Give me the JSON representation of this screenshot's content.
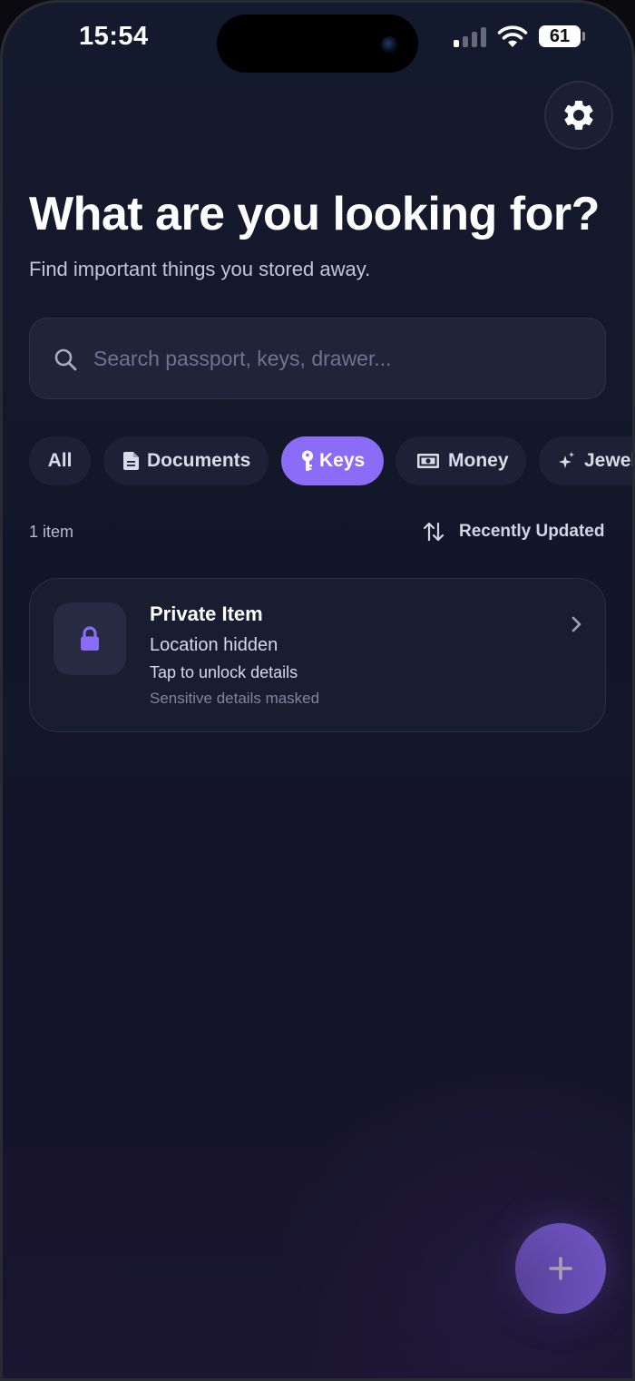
{
  "status_bar": {
    "time": "15:54",
    "battery": "61",
    "icons": [
      "cellular-signal-icon",
      "wifi-icon",
      "battery-icon"
    ]
  },
  "header": {
    "title": "What are you looking for?",
    "subtitle": "Find important things you stored away.",
    "settings_icon": "gear-icon"
  },
  "search": {
    "placeholder": "Search passport, keys, drawer...",
    "value": "",
    "icon": "search-icon"
  },
  "filters": [
    {
      "label": "All",
      "icon": "",
      "active": false
    },
    {
      "label": "Documents",
      "icon": "document-icon",
      "active": false
    },
    {
      "label": "Keys",
      "icon": "key-icon",
      "active": true
    },
    {
      "label": "Money",
      "icon": "banknote-icon",
      "active": false
    },
    {
      "label": "Jewel",
      "icon": "sparkle-icon",
      "active": false
    }
  ],
  "results": {
    "count": "1 item",
    "sort_label": "Recently Updated",
    "sort_icon": "sort-arrows-icon"
  },
  "items": [
    {
      "title": "Private Item",
      "location": "Location hidden",
      "hint": "Tap to unlock details",
      "note": "Sensitive details masked",
      "icon": "lock-icon"
    }
  ],
  "fab": {
    "icon": "plus-icon"
  },
  "colors": {
    "accent": "#8b6cf6",
    "background": "#131629",
    "surface": "#1d2136",
    "text_primary": "#ffffff",
    "text_muted": "#80859c"
  }
}
